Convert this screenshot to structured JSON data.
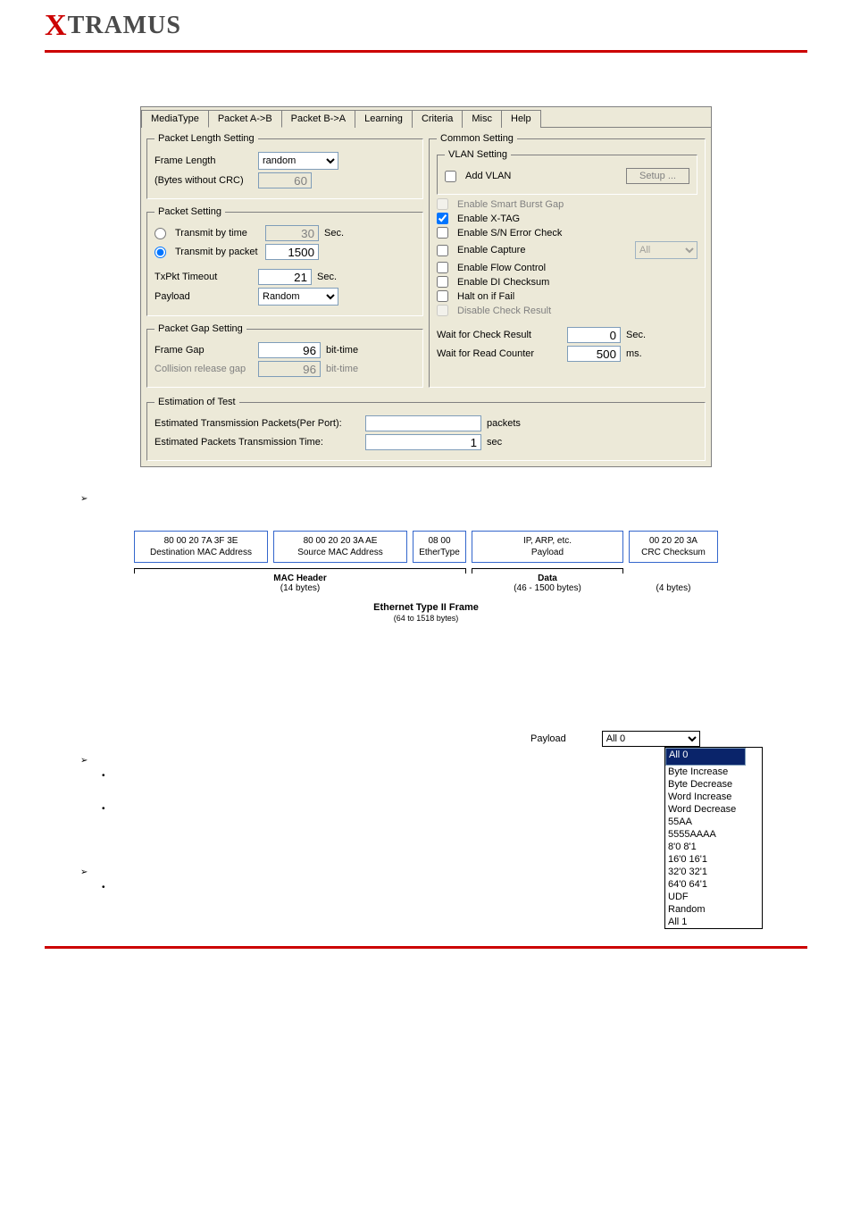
{
  "brand": {
    "prefix": "X",
    "rest": "TRAMUS"
  },
  "tabs": [
    "MediaType",
    "Packet A->B",
    "Packet B->A",
    "Learning",
    "Criteria",
    "Misc",
    "Help"
  ],
  "activeTab": 1,
  "packetLengthSetting": {
    "legend": "Packet Length Setting",
    "frameLengthLabel": "Frame Length",
    "frameLengthValue": "random",
    "bytesNote": "(Bytes without CRC)",
    "bytesValue": "60"
  },
  "packetSetting": {
    "legend": "Packet Setting",
    "transmitByTimeLabel": "Transmit by time",
    "transmitByTimeValue": "30",
    "transmitByTimeUnit": "Sec.",
    "transmitByPacketLabel": "Transmit by packet",
    "transmitByPacketValue": "1500",
    "txPktTimeoutLabel": "TxPkt Timeout",
    "txPktTimeoutValue": "21",
    "txPktTimeoutUnit": "Sec.",
    "payloadLabel": "Payload",
    "payloadValue": "Random"
  },
  "packetGapSetting": {
    "legend": "Packet Gap Setting",
    "frameGapLabel": "Frame Gap",
    "frameGapValue": "96",
    "frameGapUnit": "bit-time",
    "collisionLabel": "Collision release gap",
    "collisionValue": "96",
    "collisionUnit": "bit-time"
  },
  "commonSetting": {
    "legend": "Common Setting",
    "vlanLegend": "VLAN Setting",
    "addVlanLabel": "Add VLAN",
    "setupBtn": "Setup ...",
    "smartBurstGap": "Enable Smart Burst Gap",
    "xtag": "Enable X-TAG",
    "snError": "Enable S/N Error Check",
    "capture": "Enable Capture",
    "captureSel": "All",
    "flowControl": "Enable Flow Control",
    "diChecksum": "Enable DI Checksum",
    "haltOnFail": "Halt on if Fail",
    "disableCheck": "Disable Check Result",
    "waitCheckLabel": "Wait for Check Result",
    "waitCheckValue": "0",
    "waitCheckUnit": "Sec.",
    "waitReadLabel": "Wait for Read Counter",
    "waitReadValue": "500",
    "waitReadUnit": "ms."
  },
  "estimation": {
    "legend": "Estimation of Test",
    "packetsLabel": "Estimated Transmission Packets(Per Port):",
    "packetsValue": "",
    "packetsUnit": "packets",
    "timeLabel": "Estimated Packets Transmission Time:",
    "timeValue": "1",
    "timeUnit": "sec"
  },
  "frameDiagram": {
    "dest": {
      "hex": "80 00 20 7A 3F 3E",
      "label": "Destination MAC Address"
    },
    "src": {
      "hex": "80 00 20 20 3A AE",
      "label": "Source MAC Address"
    },
    "etype": {
      "hex": "08 00",
      "label": "EtherType"
    },
    "payload": {
      "title": "IP, ARP, etc.",
      "label": "Payload"
    },
    "crc": {
      "hex": "00 20 20 3A",
      "label": "CRC Checksum"
    },
    "macHeader": {
      "title": "MAC Header",
      "sub": "(14 bytes)"
    },
    "data": {
      "title": "Data",
      "sub": "(46 - 1500 bytes)"
    },
    "crcBytes": "(4 bytes)",
    "frameTitle": "Ethernet Type II Frame",
    "frameSub": "(64 to 1518 bytes)"
  },
  "payloadDropdown": {
    "label": "Payload",
    "selected": "All 0",
    "options": [
      "All 0",
      "Byte Increase",
      "Byte Decrease",
      "Word Increase",
      "Word Decrease",
      "55AA",
      "5555AAAA",
      "8'0 8'1",
      "16'0 16'1",
      "32'0 32'1",
      "64'0 64'1",
      "UDF",
      "Random",
      "All 1"
    ]
  }
}
